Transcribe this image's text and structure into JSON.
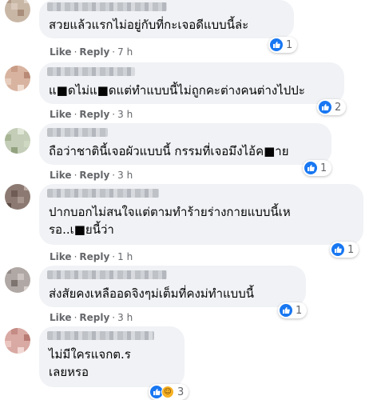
{
  "comments": [
    {
      "text_lines": [
        "สวยแล้วแรกไม่อยู่กับที่กะเจอดีแบบนี้ล่ะ"
      ],
      "reaction_count": "1",
      "like": "Like",
      "reply": "Reply",
      "time": "7 h"
    },
    {
      "text_lines": [
        "แ■ดไม่แ■ดแต่ทำแบบนี้ไม่ถูกคะต่างคนต่างไปปะ"
      ],
      "reaction_count": "2",
      "like": "Like",
      "reply": "Reply",
      "time": "3 h"
    },
    {
      "text_lines": [
        "ถือว่าชาตินี้เจอผัวแบบนี้ กรรมที่เจอมึงไอ้ค■าย"
      ],
      "reaction_count": "1",
      "like": "Like",
      "reply": "Reply",
      "time": "3 h"
    },
    {
      "text_lines": [
        "ปากบอกไม่สนใจแต่ตามทำร้ายร่างกายแบบนี้เห",
        "รอ..เ■ยนี้ว่า"
      ],
      "reaction_count": "1",
      "like": "Like",
      "reply": "Reply",
      "time": "1 h"
    },
    {
      "text_lines": [
        "ส่งสัยคงเหลืออดจิงๆม่เต็มที่คงม่ทำแบบนี้"
      ],
      "reaction_count": "1",
      "like": "Like",
      "reply": "Reply",
      "time": "3 h"
    },
    {
      "text_lines": [
        "ไม่มีใครแจกต.ร",
        "เลยหรอ"
      ],
      "reaction_count": "3"
    }
  ],
  "colors": {
    "bubble": "#f0f2f5",
    "like_blue": "#1877f2",
    "meta_gray": "#65676b"
  }
}
